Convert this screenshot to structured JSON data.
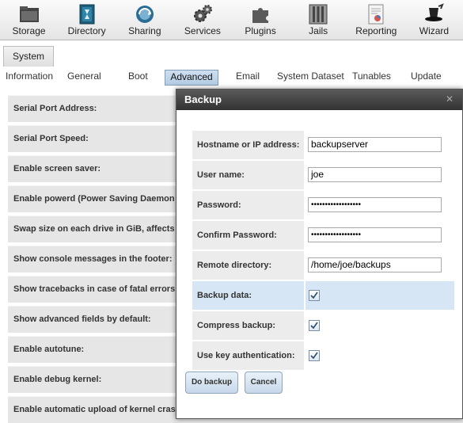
{
  "toolbar": {
    "items": [
      {
        "label": "Storage",
        "icon": "storage-icon"
      },
      {
        "label": "Directory",
        "icon": "directory-icon"
      },
      {
        "label": "Sharing",
        "icon": "sharing-icon"
      },
      {
        "label": "Services",
        "icon": "services-icon"
      },
      {
        "label": "Plugins",
        "icon": "plugins-icon"
      },
      {
        "label": "Jails",
        "icon": "jails-icon"
      },
      {
        "label": "Reporting",
        "icon": "reporting-icon"
      },
      {
        "label": "Wizard",
        "icon": "wizard-icon"
      }
    ]
  },
  "tabs": {
    "main": "System",
    "sub": [
      {
        "label": "Information"
      },
      {
        "label": "General"
      },
      {
        "label": "Boot"
      },
      {
        "label": "Advanced",
        "active": true
      },
      {
        "label": "Email"
      },
      {
        "label": "System Dataset"
      },
      {
        "label": "Tunables"
      },
      {
        "label": "Update"
      }
    ]
  },
  "settings": {
    "rows": [
      "Serial Port Address:",
      "Serial Port Speed:",
      "Enable screen saver:",
      "Enable powerd (Power Saving Daemon",
      "Swap size on each drive in GiB, affects",
      "Show console messages in the footer:",
      "Show tracebacks in case of fatal errors",
      "Show advanced fields by default:",
      "Enable autotune:",
      "Enable debug kernel:",
      "Enable automatic upload of kernel crash dumps:"
    ]
  },
  "dialog": {
    "title": "Backup",
    "close_icon": "close-icon",
    "fields": {
      "hostname": {
        "label": "Hostname or IP address:",
        "value": "backupserver"
      },
      "username": {
        "label": "User name:",
        "value": "joe"
      },
      "password": {
        "label": "Password:",
        "value": "••••••••••••••••••"
      },
      "confirm_password": {
        "label": "Confirm Password:",
        "value": "••••••••••••••••••"
      },
      "remote_directory": {
        "label": "Remote directory:",
        "value": "/home/joe/backups"
      },
      "backup_data": {
        "label": "Backup data:",
        "checked": true
      },
      "compress_backup": {
        "label": "Compress backup:",
        "checked": true
      },
      "use_key_auth": {
        "label": "Use key authentication:",
        "checked": true
      }
    },
    "buttons": {
      "do_backup": "Do backup",
      "cancel": "Cancel"
    }
  },
  "colors": {
    "dialog_title_bg": "#3f3f3f",
    "highlight_row": "#d7e6f4",
    "active_tab": "#b3cbe3",
    "button_bg": "#c7d8ea"
  }
}
